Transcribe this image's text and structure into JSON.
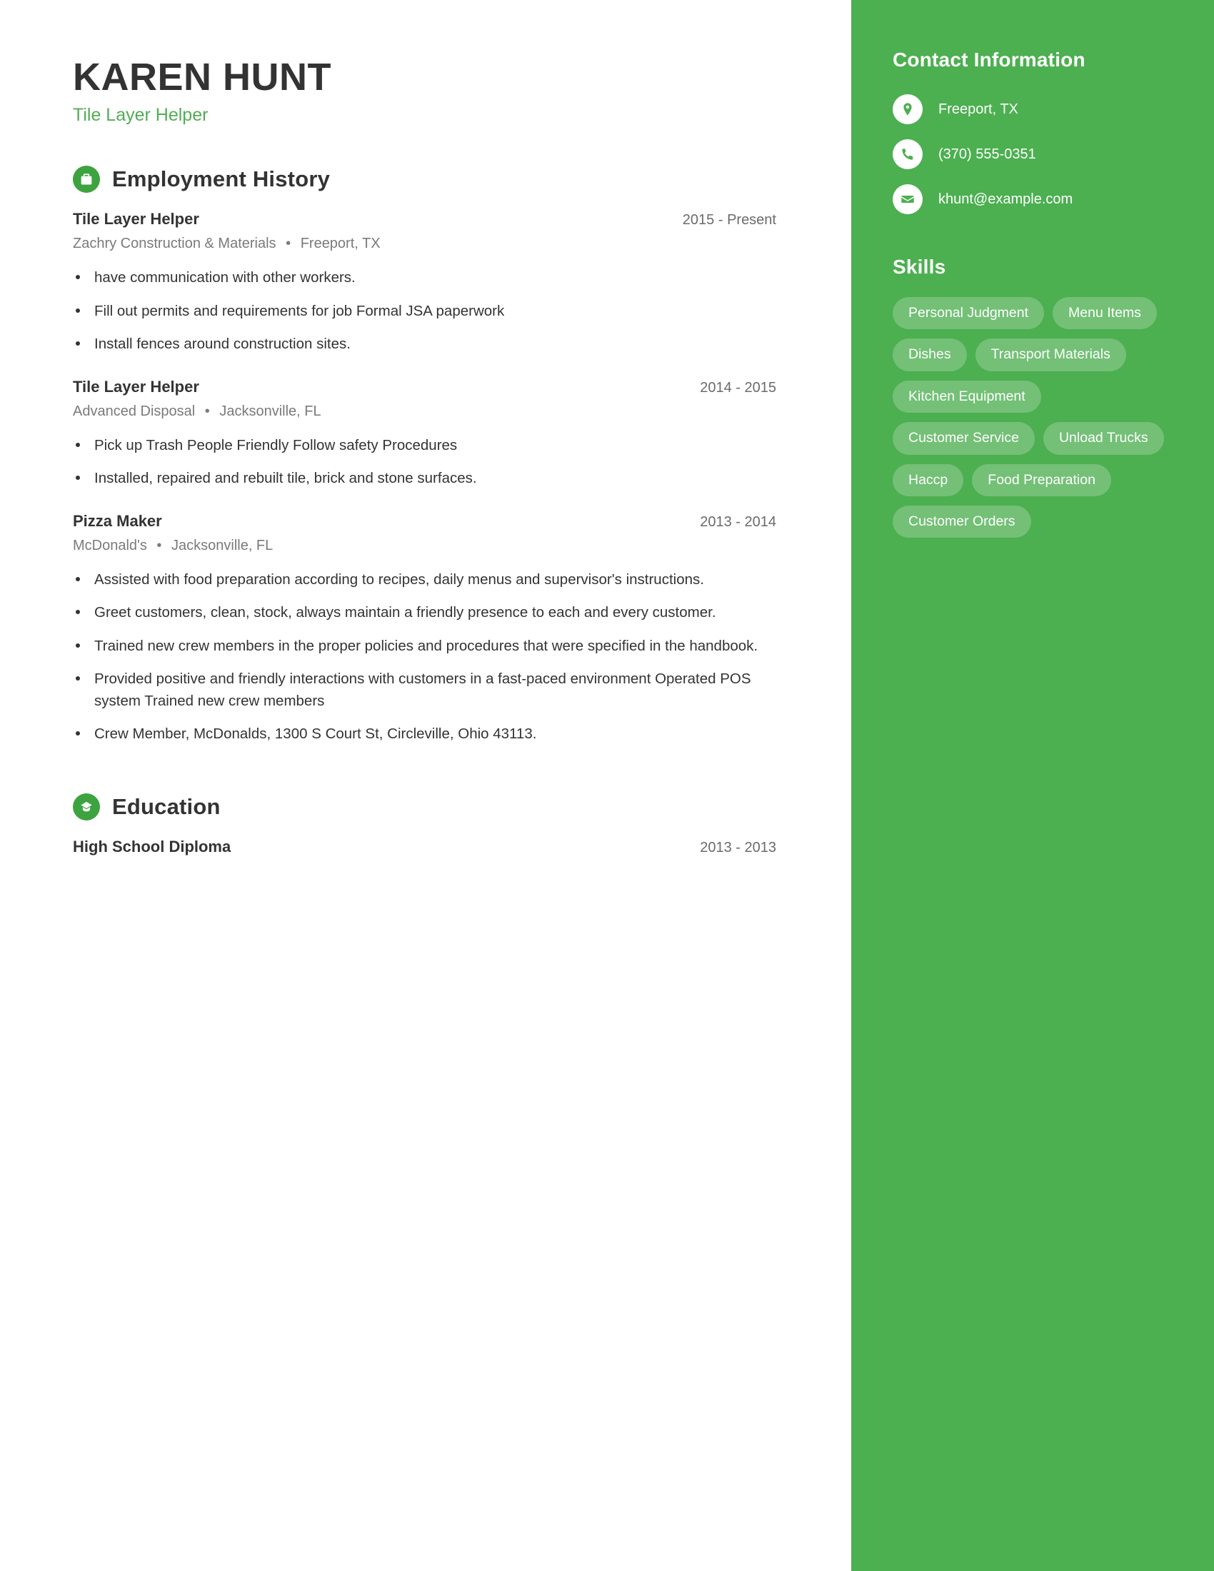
{
  "header": {
    "name": "KAREN HUNT",
    "headline": "Tile Layer Helper"
  },
  "colors": {
    "accent_green": "#4caf50",
    "icon_green": "#3da33f",
    "headline_green": "#52ad55",
    "body_text": "#333333",
    "muted_text": "#7a7a7a"
  },
  "employment": {
    "section_title": "Employment History",
    "icon": "briefcase-icon",
    "entries": [
      {
        "role": "Tile Layer Helper",
        "dates": "2015 - Present",
        "company": "Zachry Construction & Materials",
        "location": "Freeport, TX",
        "bullets": [
          "have communication with other workers.",
          "Fill out permits and requirements for job Formal JSA paperwork",
          "Install fences around construction sites."
        ]
      },
      {
        "role": "Tile Layer Helper",
        "dates": "2014 - 2015",
        "company": "Advanced Disposal",
        "location": "Jacksonville, FL",
        "bullets": [
          "Pick up Trash People Friendly Follow safety Procedures",
          "Installed, repaired and rebuilt tile, brick and stone surfaces."
        ]
      },
      {
        "role": "Pizza Maker",
        "dates": "2013 - 2014",
        "company": "McDonald's",
        "location": "Jacksonville, FL",
        "bullets": [
          "Assisted with food preparation according to recipes, daily menus and supervisor's instructions.",
          "Greet customers, clean, stock, always maintain a friendly presence to each and every customer.",
          "Trained new crew members in the proper policies and procedures that were specified in the handbook.",
          "Provided positive and friendly interactions with customers in a fast-paced environment Operated POS system Trained new crew members",
          "Crew Member, McDonalds, 1300 S Court St, Circleville, Ohio 43113."
        ]
      }
    ]
  },
  "education": {
    "section_title": "Education",
    "icon": "graduation-cap-icon",
    "entries": [
      {
        "degree": "High School Diploma",
        "dates": "2013 - 2013"
      }
    ]
  },
  "sidebar": {
    "contact_title": "Contact Information",
    "contact": [
      {
        "icon": "location-pin-icon",
        "value": "Freeport, TX"
      },
      {
        "icon": "phone-icon",
        "value": "(370) 555-0351"
      },
      {
        "icon": "envelope-icon",
        "value": "khunt@example.com"
      }
    ],
    "skills_title": "Skills",
    "skills": [
      "Personal Judgment",
      "Menu Items",
      "Dishes",
      "Transport Materials",
      "Kitchen Equipment",
      "Customer Service",
      "Unload Trucks",
      "Haccp",
      "Food Preparation",
      "Customer Orders"
    ]
  }
}
